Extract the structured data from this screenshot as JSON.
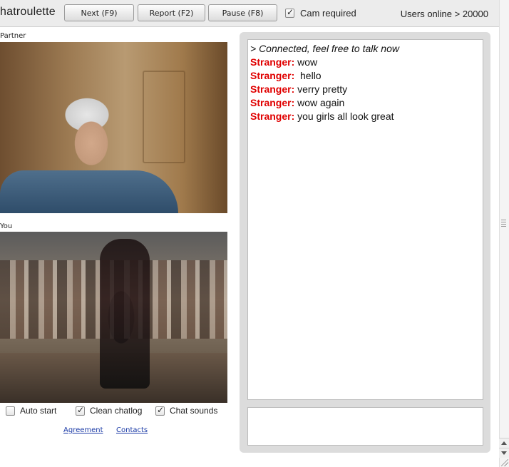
{
  "app": {
    "title": "hatroulette"
  },
  "toolbar": {
    "next_label": "Next (F9)",
    "report_label": "Report (F2)",
    "pause_label": "Pause (F8)",
    "cam_required_label": "Cam required",
    "cam_required_checked": true,
    "users_online": "Users online > 20000"
  },
  "videos": {
    "partner_label": "Partner",
    "you_label": "You"
  },
  "options": {
    "auto_start": {
      "label": "Auto start",
      "checked": false
    },
    "clean_chatlog": {
      "label": "Clean chatlog",
      "checked": true
    },
    "chat_sounds": {
      "label": "Chat sounds",
      "checked": true
    }
  },
  "links": {
    "agreement": "Agreement",
    "contacts": "Contacts"
  },
  "chat": {
    "system_message": "> Connected, feel free to talk now",
    "messages": [
      {
        "sender": "Stranger:",
        "text": " wow"
      },
      {
        "sender": "Stranger:",
        "text": "  hello"
      },
      {
        "sender": "Stranger:",
        "text": " verry pretty"
      },
      {
        "sender": "Stranger:",
        "text": " wow again"
      },
      {
        "sender": "Stranger:",
        "text": " you girls all look great"
      }
    ],
    "input_value": ""
  },
  "colors": {
    "sender": "#e00000",
    "link": "#1a3aa6",
    "chat_frame": "#dcdcdc"
  },
  "icons": [
    "checkbox-icon",
    "scroll-up-arrow-icon",
    "scroll-down-arrow-icon",
    "resize-grip-icon"
  ]
}
